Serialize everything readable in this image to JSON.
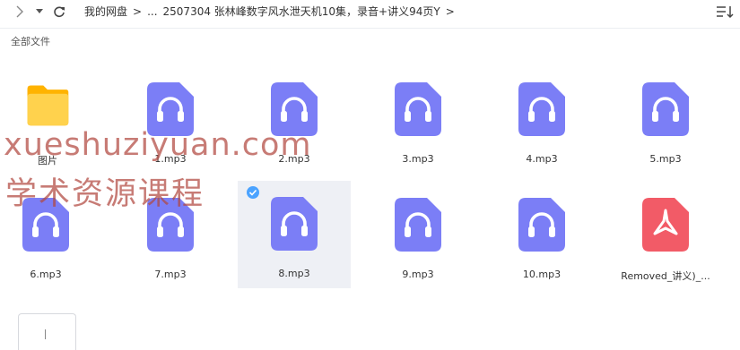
{
  "breadcrumb": {
    "root": "我的网盘",
    "sep1": ">",
    "ellipsis": "...",
    "current": "2507304 张林峰数字风水泄天机10集，录音+讲义94页Y",
    "sep2": ">"
  },
  "subtitle": "全部文件",
  "items": [
    {
      "name": "图片",
      "type": "folder"
    },
    {
      "name": "1.mp3",
      "type": "audio"
    },
    {
      "name": "2.mp3",
      "type": "audio"
    },
    {
      "name": "3.mp3",
      "type": "audio"
    },
    {
      "name": "4.mp3",
      "type": "audio"
    },
    {
      "name": "5.mp3",
      "type": "audio"
    },
    {
      "name": "6.mp3",
      "type": "audio"
    },
    {
      "name": "7.mp3",
      "type": "audio"
    },
    {
      "name": "8.mp3",
      "type": "audio",
      "selected": true
    },
    {
      "name": "9.mp3",
      "type": "audio"
    },
    {
      "name": "10.mp3",
      "type": "audio"
    },
    {
      "name": "Removed_讲义)_...",
      "type": "pdf"
    }
  ],
  "watermark": {
    "line1": "xueshuziyuan.com",
    "line2": "学术资源课程"
  },
  "colors": {
    "audio": "#7b7ef6",
    "folder": "#ffc52a",
    "pdf": "#f25b67",
    "check": "#4ba3ff"
  }
}
